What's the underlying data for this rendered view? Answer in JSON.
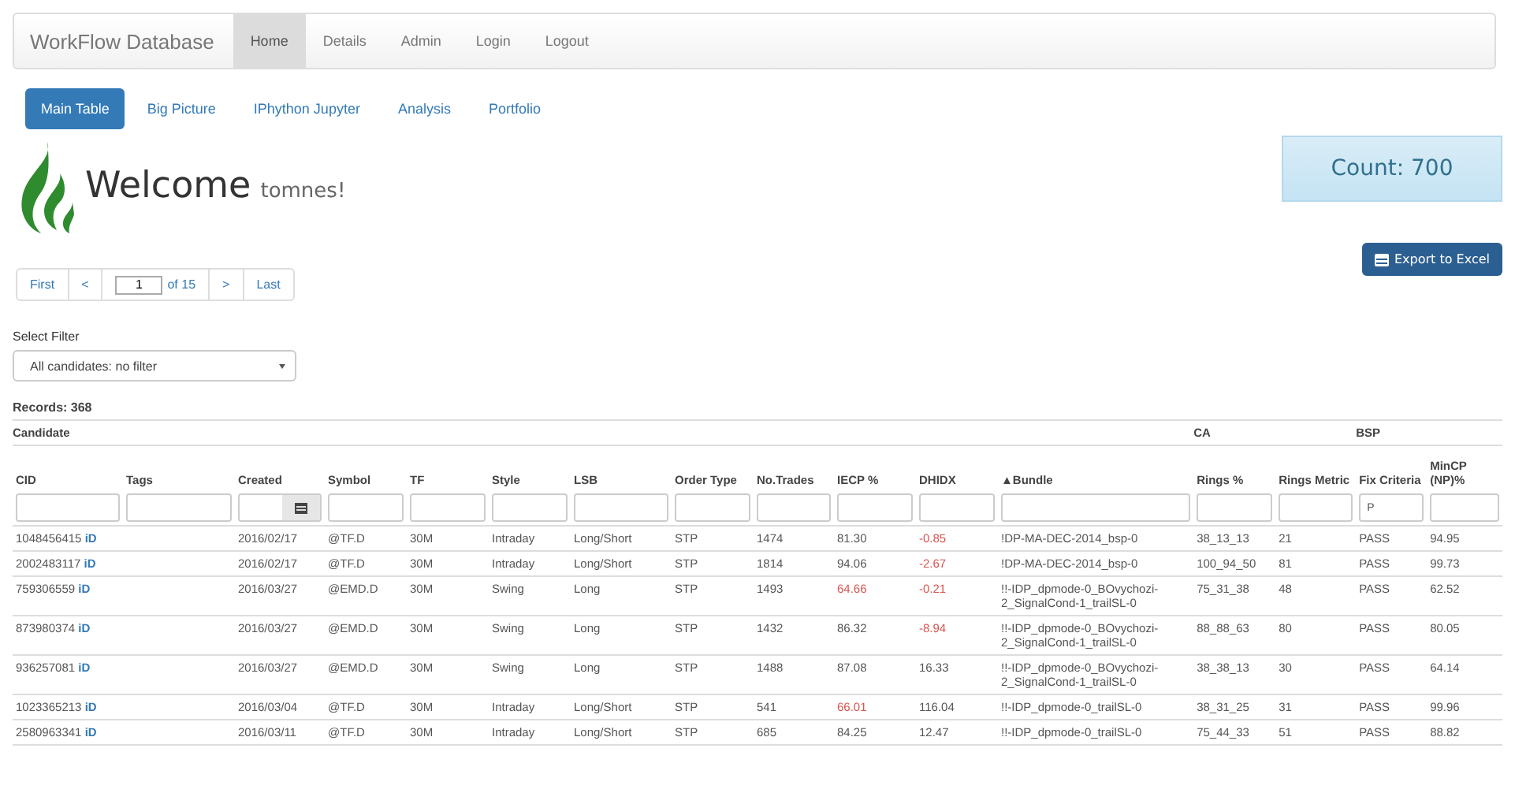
{
  "navbar": {
    "brand": "WorkFlow Database",
    "items": [
      {
        "label": "Home",
        "selected": true
      },
      {
        "label": "Details",
        "selected": false
      },
      {
        "label": "Admin",
        "selected": false
      },
      {
        "label": "Login",
        "selected": false
      },
      {
        "label": "Logout",
        "selected": false
      }
    ]
  },
  "tabs": [
    {
      "label": "Main Table",
      "selected": true
    },
    {
      "label": "Big Picture",
      "selected": false
    },
    {
      "label": "IPhython Jupyter",
      "selected": false
    },
    {
      "label": "Analysis",
      "selected": false
    },
    {
      "label": "Portfolio",
      "selected": false
    }
  ],
  "welcome": {
    "title": "Welcome",
    "user": "tomnes!"
  },
  "count": "Count: 700",
  "export_button": "Export to Excel",
  "pager": {
    "first": "First",
    "prev": "<",
    "page": "1",
    "of": "of 15",
    "next": ">",
    "last": "Last"
  },
  "filter": {
    "label": "Select Filter",
    "value": "All candidates: no filter"
  },
  "records": "Records: 368",
  "table": {
    "groups": [
      {
        "label": "Candidate"
      },
      {
        "label": "CA"
      },
      {
        "label": "BSP"
      }
    ],
    "columns": [
      {
        "label": "CID"
      },
      {
        "label": "Tags"
      },
      {
        "label": "Created",
        "kind": "date"
      },
      {
        "label": "Symbol"
      },
      {
        "label": "TF"
      },
      {
        "label": "Style"
      },
      {
        "label": "LSB"
      },
      {
        "label": "Order Type"
      },
      {
        "label": "No.Trades"
      },
      {
        "label": "IECP %"
      },
      {
        "label": "DHIDX"
      },
      {
        "label": "▲Bundle"
      },
      {
        "label": "Rings %"
      },
      {
        "label": "Rings Metric"
      },
      {
        "label": "Fix Criteria",
        "filter": "P"
      },
      {
        "label": "MinCP (NP)%"
      }
    ],
    "rows": [
      {
        "cid": "1048456415",
        "link": "iD",
        "created": "2016/02/17",
        "symbol": "@TF.D",
        "tf": "30M",
        "style": "Intraday",
        "lsb": "Long/Short",
        "order_type": "STP",
        "trades": "1474",
        "iecp": {
          "text": "81.30",
          "alert": false
        },
        "dhidx": {
          "text": "-0.85",
          "alert": true
        },
        "bundle": "!DP-MA-DEC-2014_bsp-0",
        "rings_pct": "38_13_13",
        "rings_metric": "21",
        "fix": "PASS",
        "mincp": "94.95"
      },
      {
        "cid": "2002483117",
        "link": "iD",
        "created": "2016/02/17",
        "symbol": "@TF.D",
        "tf": "30M",
        "style": "Intraday",
        "lsb": "Long/Short",
        "order_type": "STP",
        "trades": "1814",
        "iecp": {
          "text": "94.06",
          "alert": false
        },
        "dhidx": {
          "text": "-2.67",
          "alert": true
        },
        "bundle": "!DP-MA-DEC-2014_bsp-0",
        "rings_pct": "100_94_50",
        "rings_metric": "81",
        "fix": "PASS",
        "mincp": "99.73"
      },
      {
        "cid": "759306559",
        "link": "iD",
        "created": "2016/03/27",
        "symbol": "@EMD.D",
        "tf": "30M",
        "style": "Swing",
        "lsb": "Long",
        "order_type": "STP",
        "trades": "1493",
        "iecp": {
          "text": "64.66",
          "alert": true
        },
        "dhidx": {
          "text": "-0.21",
          "alert": true
        },
        "bundle": "!!-IDP_dpmode-0_BOvychozi-2_SignalCond-1_trailSL-0",
        "rings_pct": "75_31_38",
        "rings_metric": "48",
        "fix": "PASS",
        "mincp": "62.52"
      },
      {
        "cid": "873980374",
        "link": "iD",
        "created": "2016/03/27",
        "symbol": "@EMD.D",
        "tf": "30M",
        "style": "Swing",
        "lsb": "Long",
        "order_type": "STP",
        "trades": "1432",
        "iecp": {
          "text": "86.32",
          "alert": false
        },
        "dhidx": {
          "text": "-8.94",
          "alert": true
        },
        "bundle": "!!-IDP_dpmode-0_BOvychozi-2_SignalCond-1_trailSL-0",
        "rings_pct": "88_88_63",
        "rings_metric": "80",
        "fix": "PASS",
        "mincp": "80.05"
      },
      {
        "cid": "936257081",
        "link": "iD",
        "created": "2016/03/27",
        "symbol": "@EMD.D",
        "tf": "30M",
        "style": "Swing",
        "lsb": "Long",
        "order_type": "STP",
        "trades": "1488",
        "iecp": {
          "text": "87.08",
          "alert": false
        },
        "dhidx": {
          "text": "16.33",
          "alert": false
        },
        "bundle": "!!-IDP_dpmode-0_BOvychozi-2_SignalCond-1_trailSL-0",
        "rings_pct": "38_38_13",
        "rings_metric": "30",
        "fix": "PASS",
        "mincp": "64.14"
      },
      {
        "cid": "1023365213",
        "link": "iD",
        "created": "2016/03/04",
        "symbol": "@TF.D",
        "tf": "30M",
        "style": "Intraday",
        "lsb": "Long/Short",
        "order_type": "STP",
        "trades": "541",
        "iecp": {
          "text": "66.01",
          "alert": true
        },
        "dhidx": {
          "text": "116.04",
          "alert": false
        },
        "bundle": "!!-IDP_dpmode-0_trailSL-0",
        "rings_pct": "38_31_25",
        "rings_metric": "31",
        "fix": "PASS",
        "mincp": "99.96"
      },
      {
        "cid": "2580963341",
        "link": "iD",
        "created": "2016/03/11",
        "symbol": "@TF.D",
        "tf": "30M",
        "style": "Intraday",
        "lsb": "Long/Short",
        "order_type": "STP",
        "trades": "685",
        "iecp": {
          "text": "84.25",
          "alert": false
        },
        "dhidx": {
          "text": "12.47",
          "alert": false
        },
        "bundle": "!!-IDP_dpmode-0_trailSL-0",
        "rings_pct": "75_44_33",
        "rings_metric": "51",
        "fix": "PASS",
        "mincp": "88.82"
      }
    ]
  }
}
